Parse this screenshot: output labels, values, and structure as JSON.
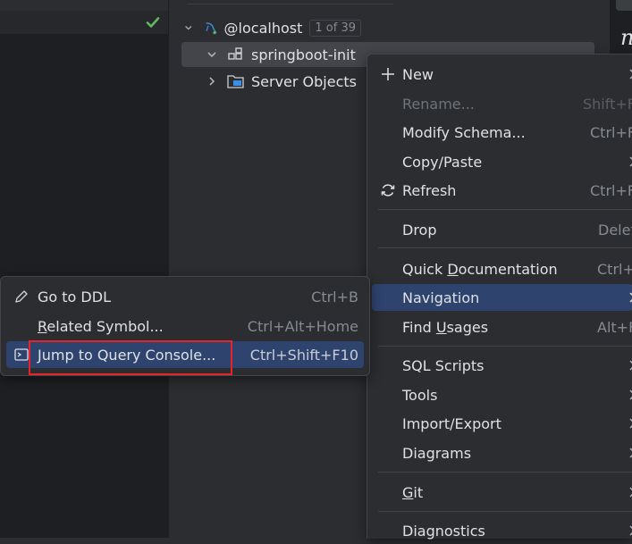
{
  "colors": {
    "editor_bg": "#1e1f22",
    "panel_bg": "#2b2d30",
    "selection_bg": "#2e436e",
    "tree_selected_bg": "#43454a",
    "text": "#dfe1e5",
    "muted": "#868a91",
    "check": "#5fb85f",
    "annotation_border": "#e5252a"
  },
  "tree": {
    "root": {
      "label": "@localhost",
      "badge": "1 of 39",
      "icon": "mysql-dolphin-icon"
    },
    "schema": {
      "label": "springboot-init",
      "icon": "schema-icon"
    },
    "server_objects": {
      "label": "Server Objects",
      "icon": "folder-icon"
    }
  },
  "context_menu": {
    "new": {
      "label": "New",
      "icon": "plus-icon"
    },
    "rename": {
      "label": "Rename...",
      "shortcut": "Shift+F"
    },
    "modify_schema": {
      "label": "Modify Schema...",
      "shortcut": "Ctrl+F"
    },
    "copy_paste": {
      "label": "Copy/Paste"
    },
    "refresh": {
      "label": "Refresh",
      "shortcut": "Ctrl+F",
      "icon": "refresh-icon"
    },
    "drop": {
      "label": "Drop",
      "shortcut": "Delet"
    },
    "quick_doc": {
      "label_pre": "Quick ",
      "label_ul": "D",
      "label_post": "ocumentation",
      "shortcut": "Ctrl+"
    },
    "navigation": {
      "label": "Navigation"
    },
    "find_usages": {
      "label_pre": "Find ",
      "label_ul": "U",
      "label_post": "sages",
      "shortcut": "Alt+F"
    },
    "sql_scripts": {
      "label": "SQL Scripts"
    },
    "tools": {
      "label": "Tools"
    },
    "import_export": {
      "label": "Import/Export"
    },
    "diagrams": {
      "label": "Diagrams"
    },
    "git": {
      "label_ul": "G",
      "label_post": "it"
    },
    "diagnostics": {
      "label": "Diagnostics"
    }
  },
  "submenu": {
    "go_to_ddl": {
      "label": "Go to DDL",
      "shortcut": "Ctrl+B",
      "icon": "pencil-icon"
    },
    "related_symbol": {
      "label_ul": "R",
      "label_post": "elated Symbol...",
      "shortcut": "Ctrl+Alt+Home"
    },
    "jump_to_console": {
      "label": "Jump to Query Console...",
      "shortcut": "Ctrl+Shift+F10",
      "icon": "console-icon"
    }
  },
  "right_strip": {
    "letter": "n"
  }
}
